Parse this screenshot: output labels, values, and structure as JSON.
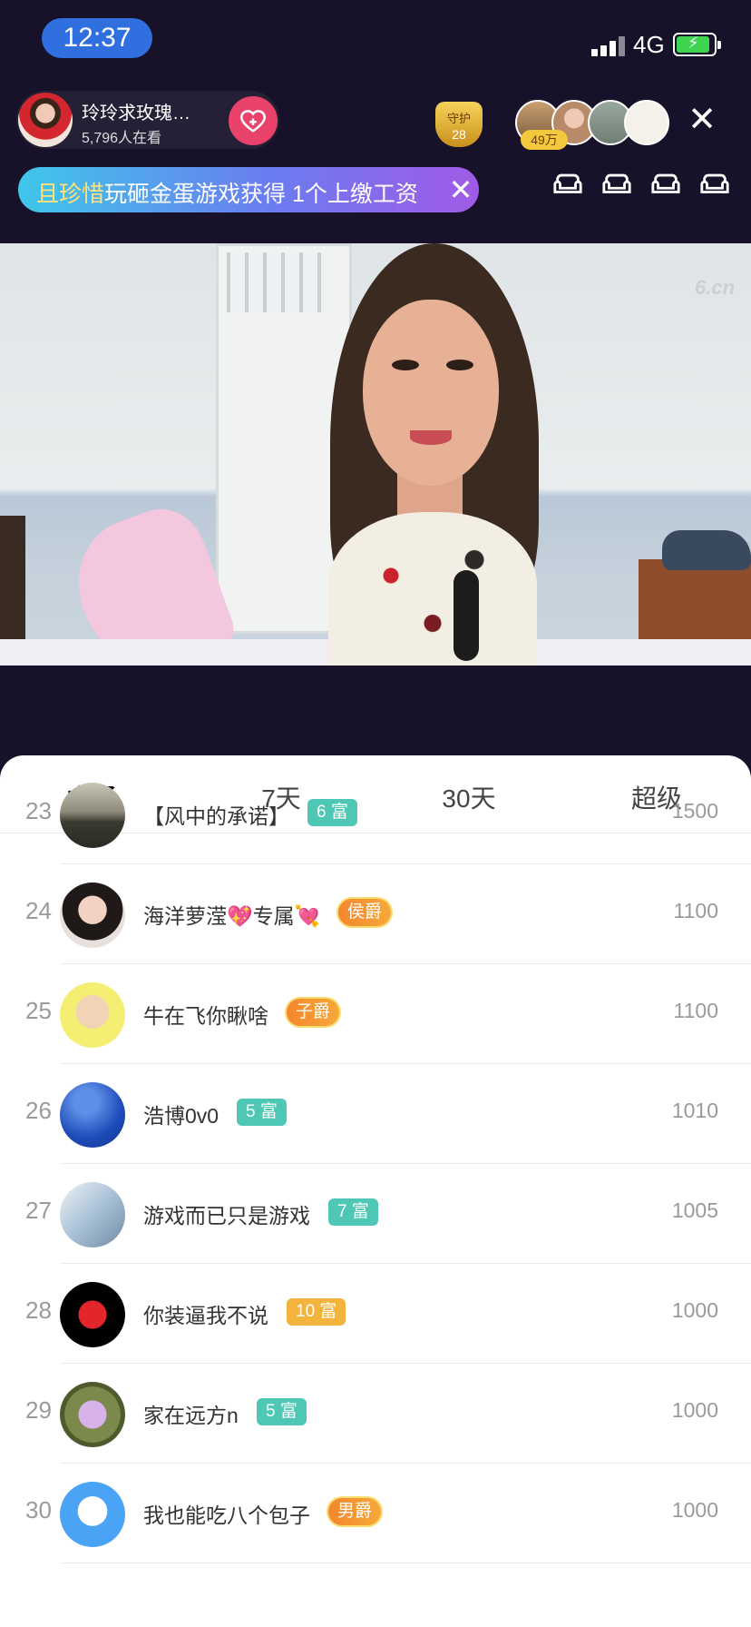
{
  "status_bar": {
    "time": "12:37",
    "network": "4G"
  },
  "header": {
    "host_name": "玲玲求玫瑰…",
    "viewers": "5,796人在看",
    "guard_label": "守护",
    "guard_count": "28",
    "audience_count": "49万"
  },
  "notice": {
    "highlight_name": "且珍惜",
    "message": "玩砸金蛋游戏获得 1个上缴工资"
  },
  "video": {
    "watermark": "6.cn"
  },
  "tabs": [
    {
      "label": "本场",
      "active": true
    },
    {
      "label": "7天",
      "active": false
    },
    {
      "label": "30天",
      "active": false
    },
    {
      "label": "超级",
      "active": false
    }
  ],
  "ranking": [
    {
      "rank": "23",
      "name": "【风中的承诺】",
      "badge": "6 富",
      "badge_type": "rich-teal",
      "score": "1500"
    },
    {
      "rank": "24",
      "name": "海洋萝滢💖专属💘",
      "badge": "侯爵",
      "badge_type": "noble",
      "score": "1100"
    },
    {
      "rank": "25",
      "name": "牛在飞你瞅啥",
      "badge": "子爵",
      "badge_type": "noble",
      "score": "1100"
    },
    {
      "rank": "26",
      "name": "浩博0v0",
      "badge": "5 富",
      "badge_type": "rich-teal",
      "score": "1010"
    },
    {
      "rank": "27",
      "name": "游戏而已只是游戏",
      "badge": "7 富",
      "badge_type": "rich-teal",
      "score": "1005"
    },
    {
      "rank": "28",
      "name": "你装逼我不说",
      "badge": "10 富",
      "badge_type": "rich-orange",
      "score": "1000"
    },
    {
      "rank": "29",
      "name": "家在远方n",
      "badge": "5 富",
      "badge_type": "rich-teal",
      "score": "1000"
    },
    {
      "rank": "30",
      "name": "我也能吃八个包子",
      "badge": "男爵",
      "badge_type": "noble",
      "score": "1000"
    }
  ]
}
